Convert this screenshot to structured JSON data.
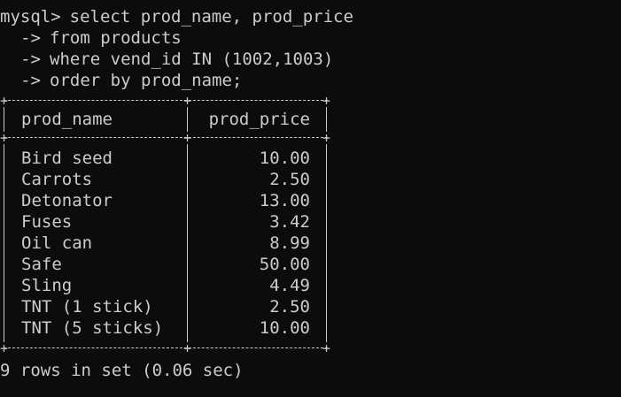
{
  "terminal": {
    "prompt": "mysql>",
    "continuation": "->",
    "command_lines": [
      "select prod_name, prod_price",
      "from products",
      "where vend_id IN (1002,1003)",
      "order by prod_name;"
    ],
    "columns": [
      "prod_name",
      "prod_price"
    ],
    "rows": [
      {
        "name": "Bird seed",
        "price": "10.00"
      },
      {
        "name": "Carrots",
        "price": "2.50"
      },
      {
        "name": "Detonator",
        "price": "13.00"
      },
      {
        "name": "Fuses",
        "price": "3.42"
      },
      {
        "name": "Oil can",
        "price": "8.99"
      },
      {
        "name": "Safe",
        "price": "50.00"
      },
      {
        "name": "Sling",
        "price": "4.49"
      },
      {
        "name": "TNT (1 stick)",
        "price": "2.50"
      },
      {
        "name": "TNT (5 sticks)",
        "price": "10.00"
      }
    ],
    "status": "9 rows in set (0.06 sec)",
    "colors": {
      "background": "#0c0c0c",
      "foreground": "#cccccc"
    }
  }
}
